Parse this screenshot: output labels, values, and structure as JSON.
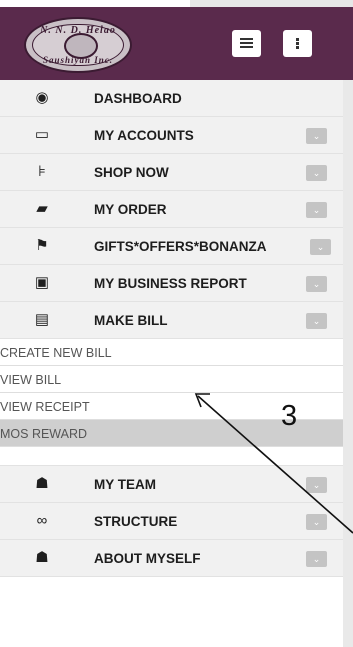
{
  "header": {
    "logo_text_top": "N. N. D. Helao",
    "logo_text_bottom": "Saushiyan Inc.",
    "menu_button_icon": "hamburger-icon",
    "more_button_icon": "vertical-dots-icon"
  },
  "menu": {
    "items": [
      {
        "label": "DASHBOARD",
        "icon": "dashboard-icon",
        "glyph": "◉"
      },
      {
        "label": "MY ACCOUNTS",
        "icon": "credit-card-icon",
        "glyph": "▭"
      },
      {
        "label": "SHOP NOW",
        "icon": "cart-icon",
        "glyph": "⊧"
      },
      {
        "label": "MY ORDER",
        "icon": "book-icon",
        "glyph": "▰"
      },
      {
        "label": "GIFTS*OFFERS*BONANZA",
        "icon": "gift-icon",
        "glyph": "⚑"
      },
      {
        "label": "MY BUSINESS REPORT",
        "icon": "money-icon",
        "glyph": "▣"
      },
      {
        "label": "MAKE BILL",
        "icon": "file-icon",
        "glyph": "▤"
      }
    ],
    "submenu": [
      {
        "label": "CREATE NEW BILL"
      },
      {
        "label": "VIEW BILL"
      },
      {
        "label": "VIEW RECEIPT"
      },
      {
        "label": "MOS REWARD",
        "active": true
      }
    ],
    "items_after": [
      {
        "label": "MY TEAM",
        "icon": "users-icon",
        "glyph": "☗"
      },
      {
        "label": "STRUCTURE",
        "icon": "link-icon",
        "glyph": "∞"
      },
      {
        "label": "ABOUT MYSELF",
        "icon": "user-icon",
        "glyph": "☗"
      }
    ],
    "chevron_glyph": "⌄"
  },
  "annotation": {
    "number": "3"
  }
}
